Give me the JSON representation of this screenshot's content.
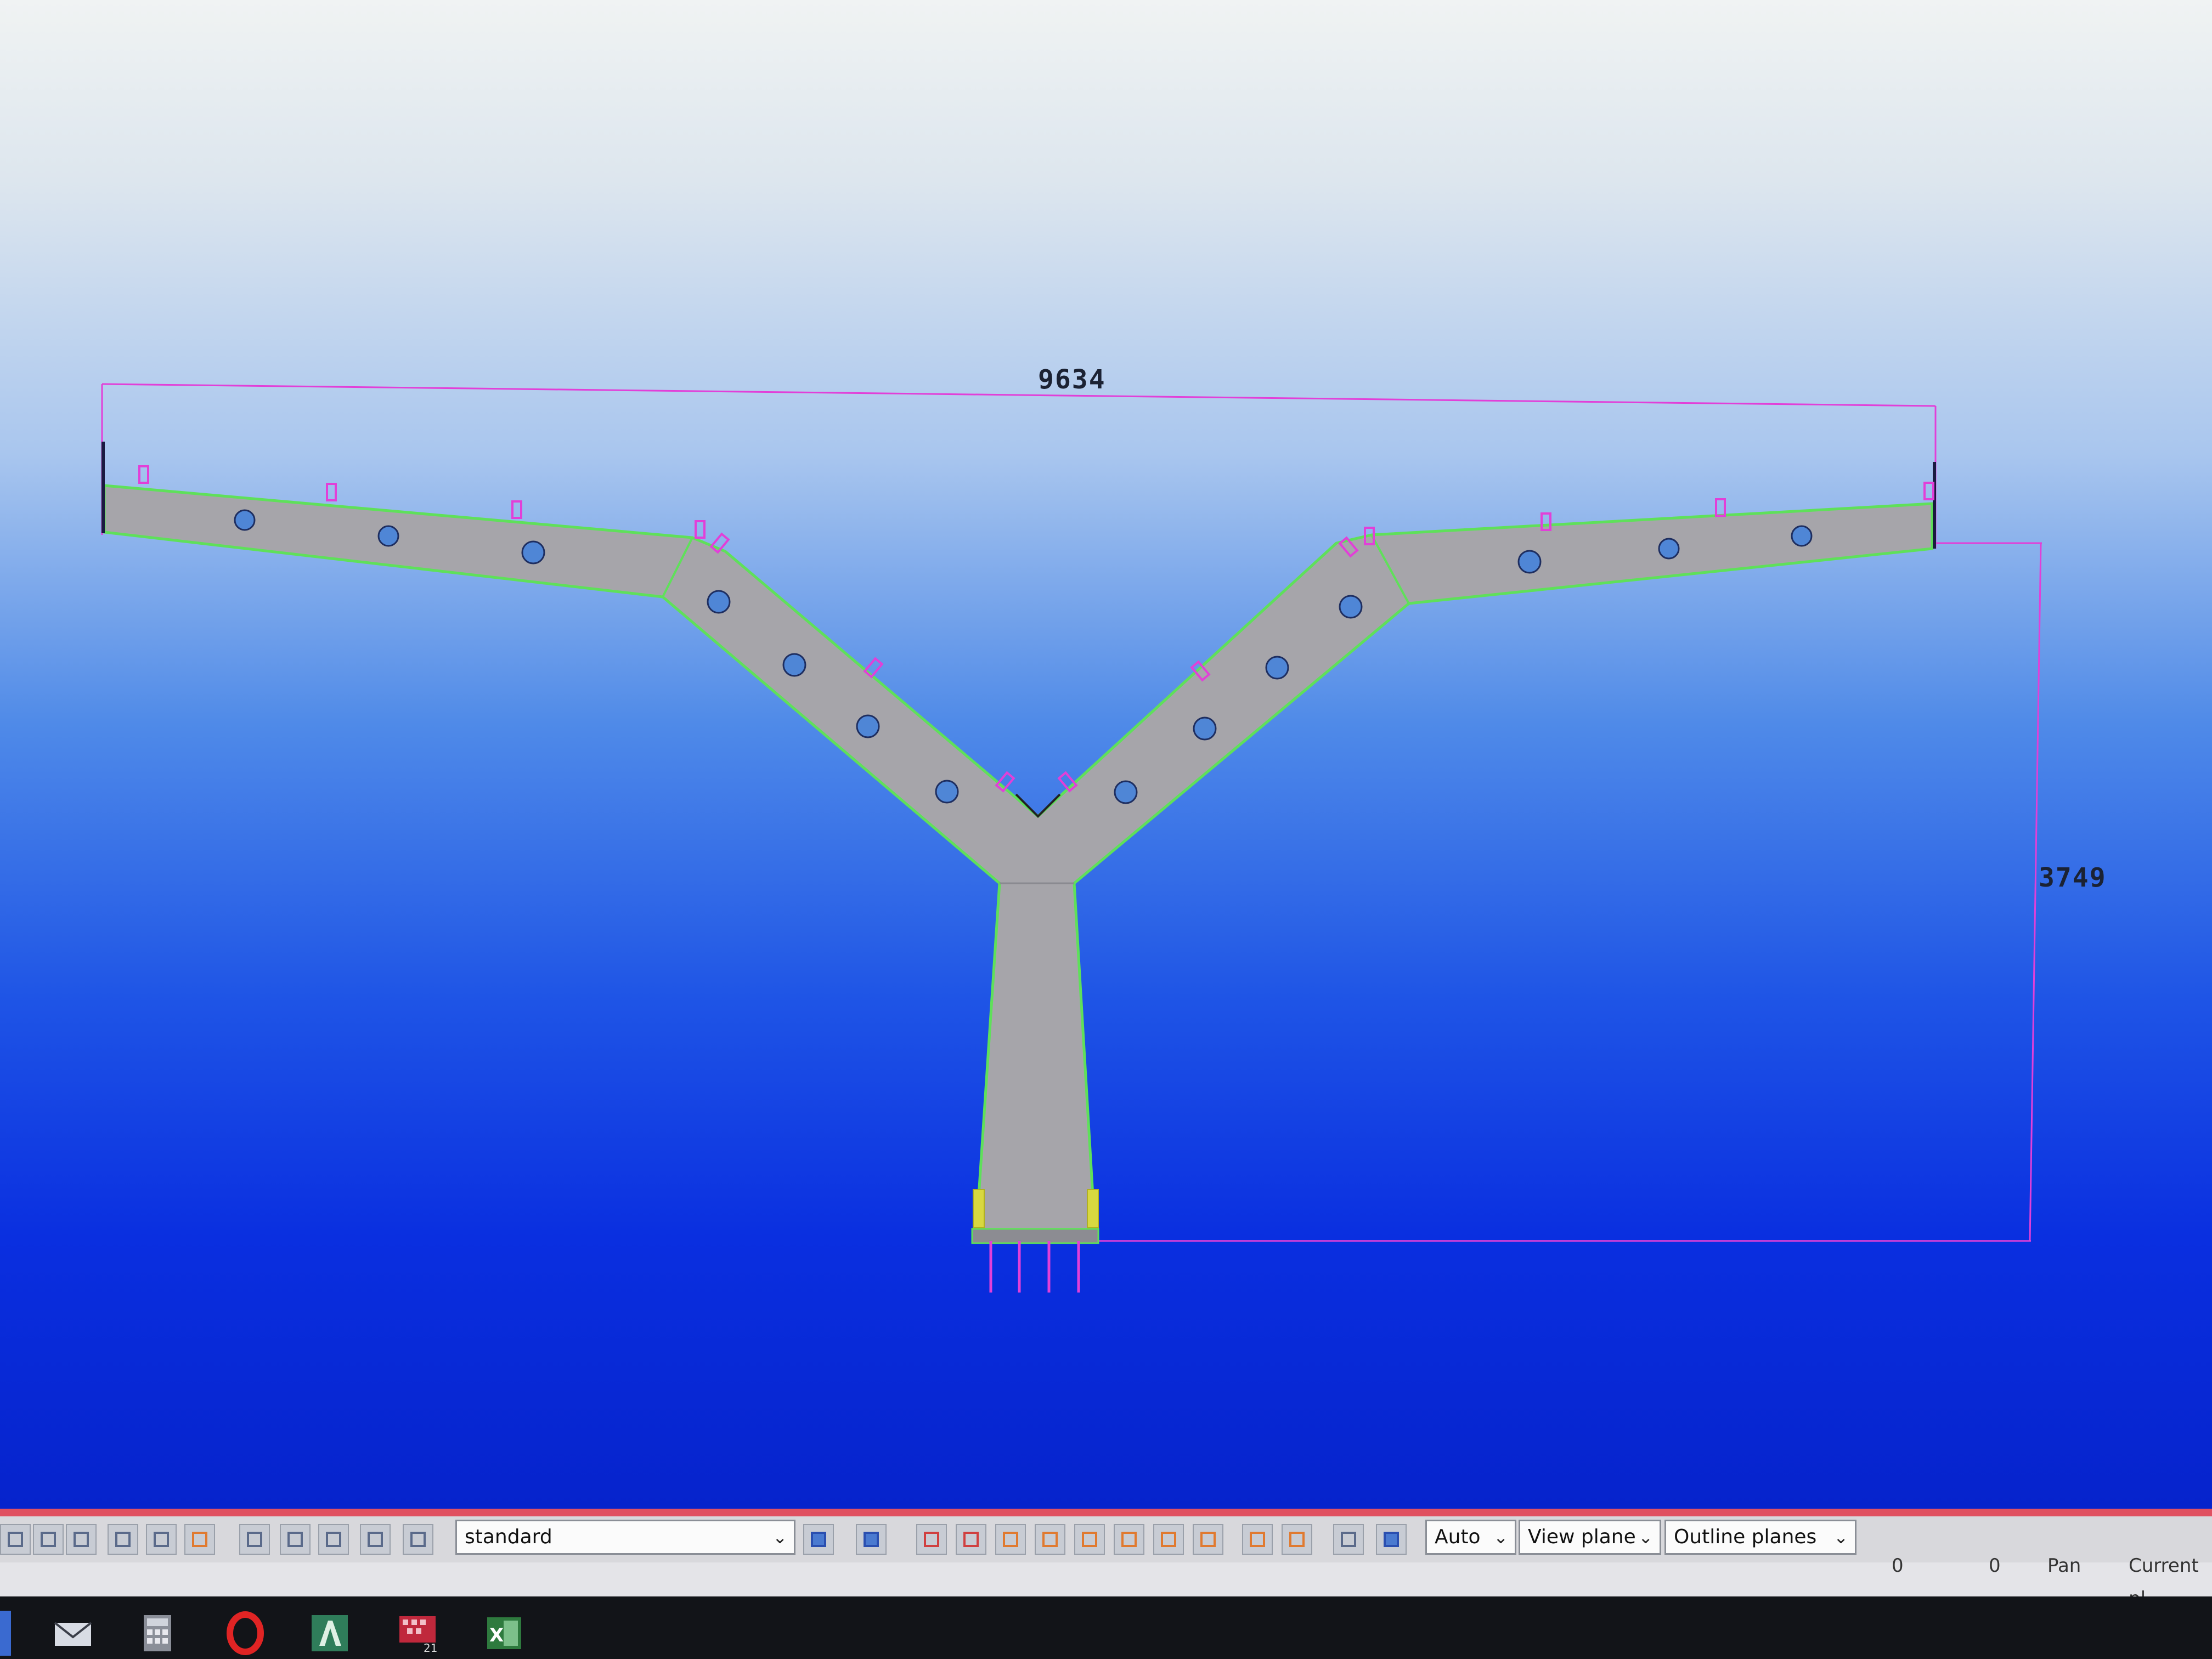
{
  "drawing": {
    "dimension_width": "9634",
    "dimension_height": "3749"
  },
  "toolbar": {
    "profile_select": "standard",
    "auto_select": "Auto",
    "view_plane_select": "View plane",
    "outline_planes_select": "Outline planes"
  },
  "statusbar": {
    "coord_x": "0",
    "coord_y": "0",
    "mode": "Pan",
    "current": "Current pl"
  },
  "taskbar": {
    "badge_count": "21"
  },
  "colors": {
    "part_fill": "#a6a5aa",
    "part_edge": "#5fe05a",
    "dimension_line": "#e23fd8",
    "bolt_hole": "#4f86d6"
  }
}
